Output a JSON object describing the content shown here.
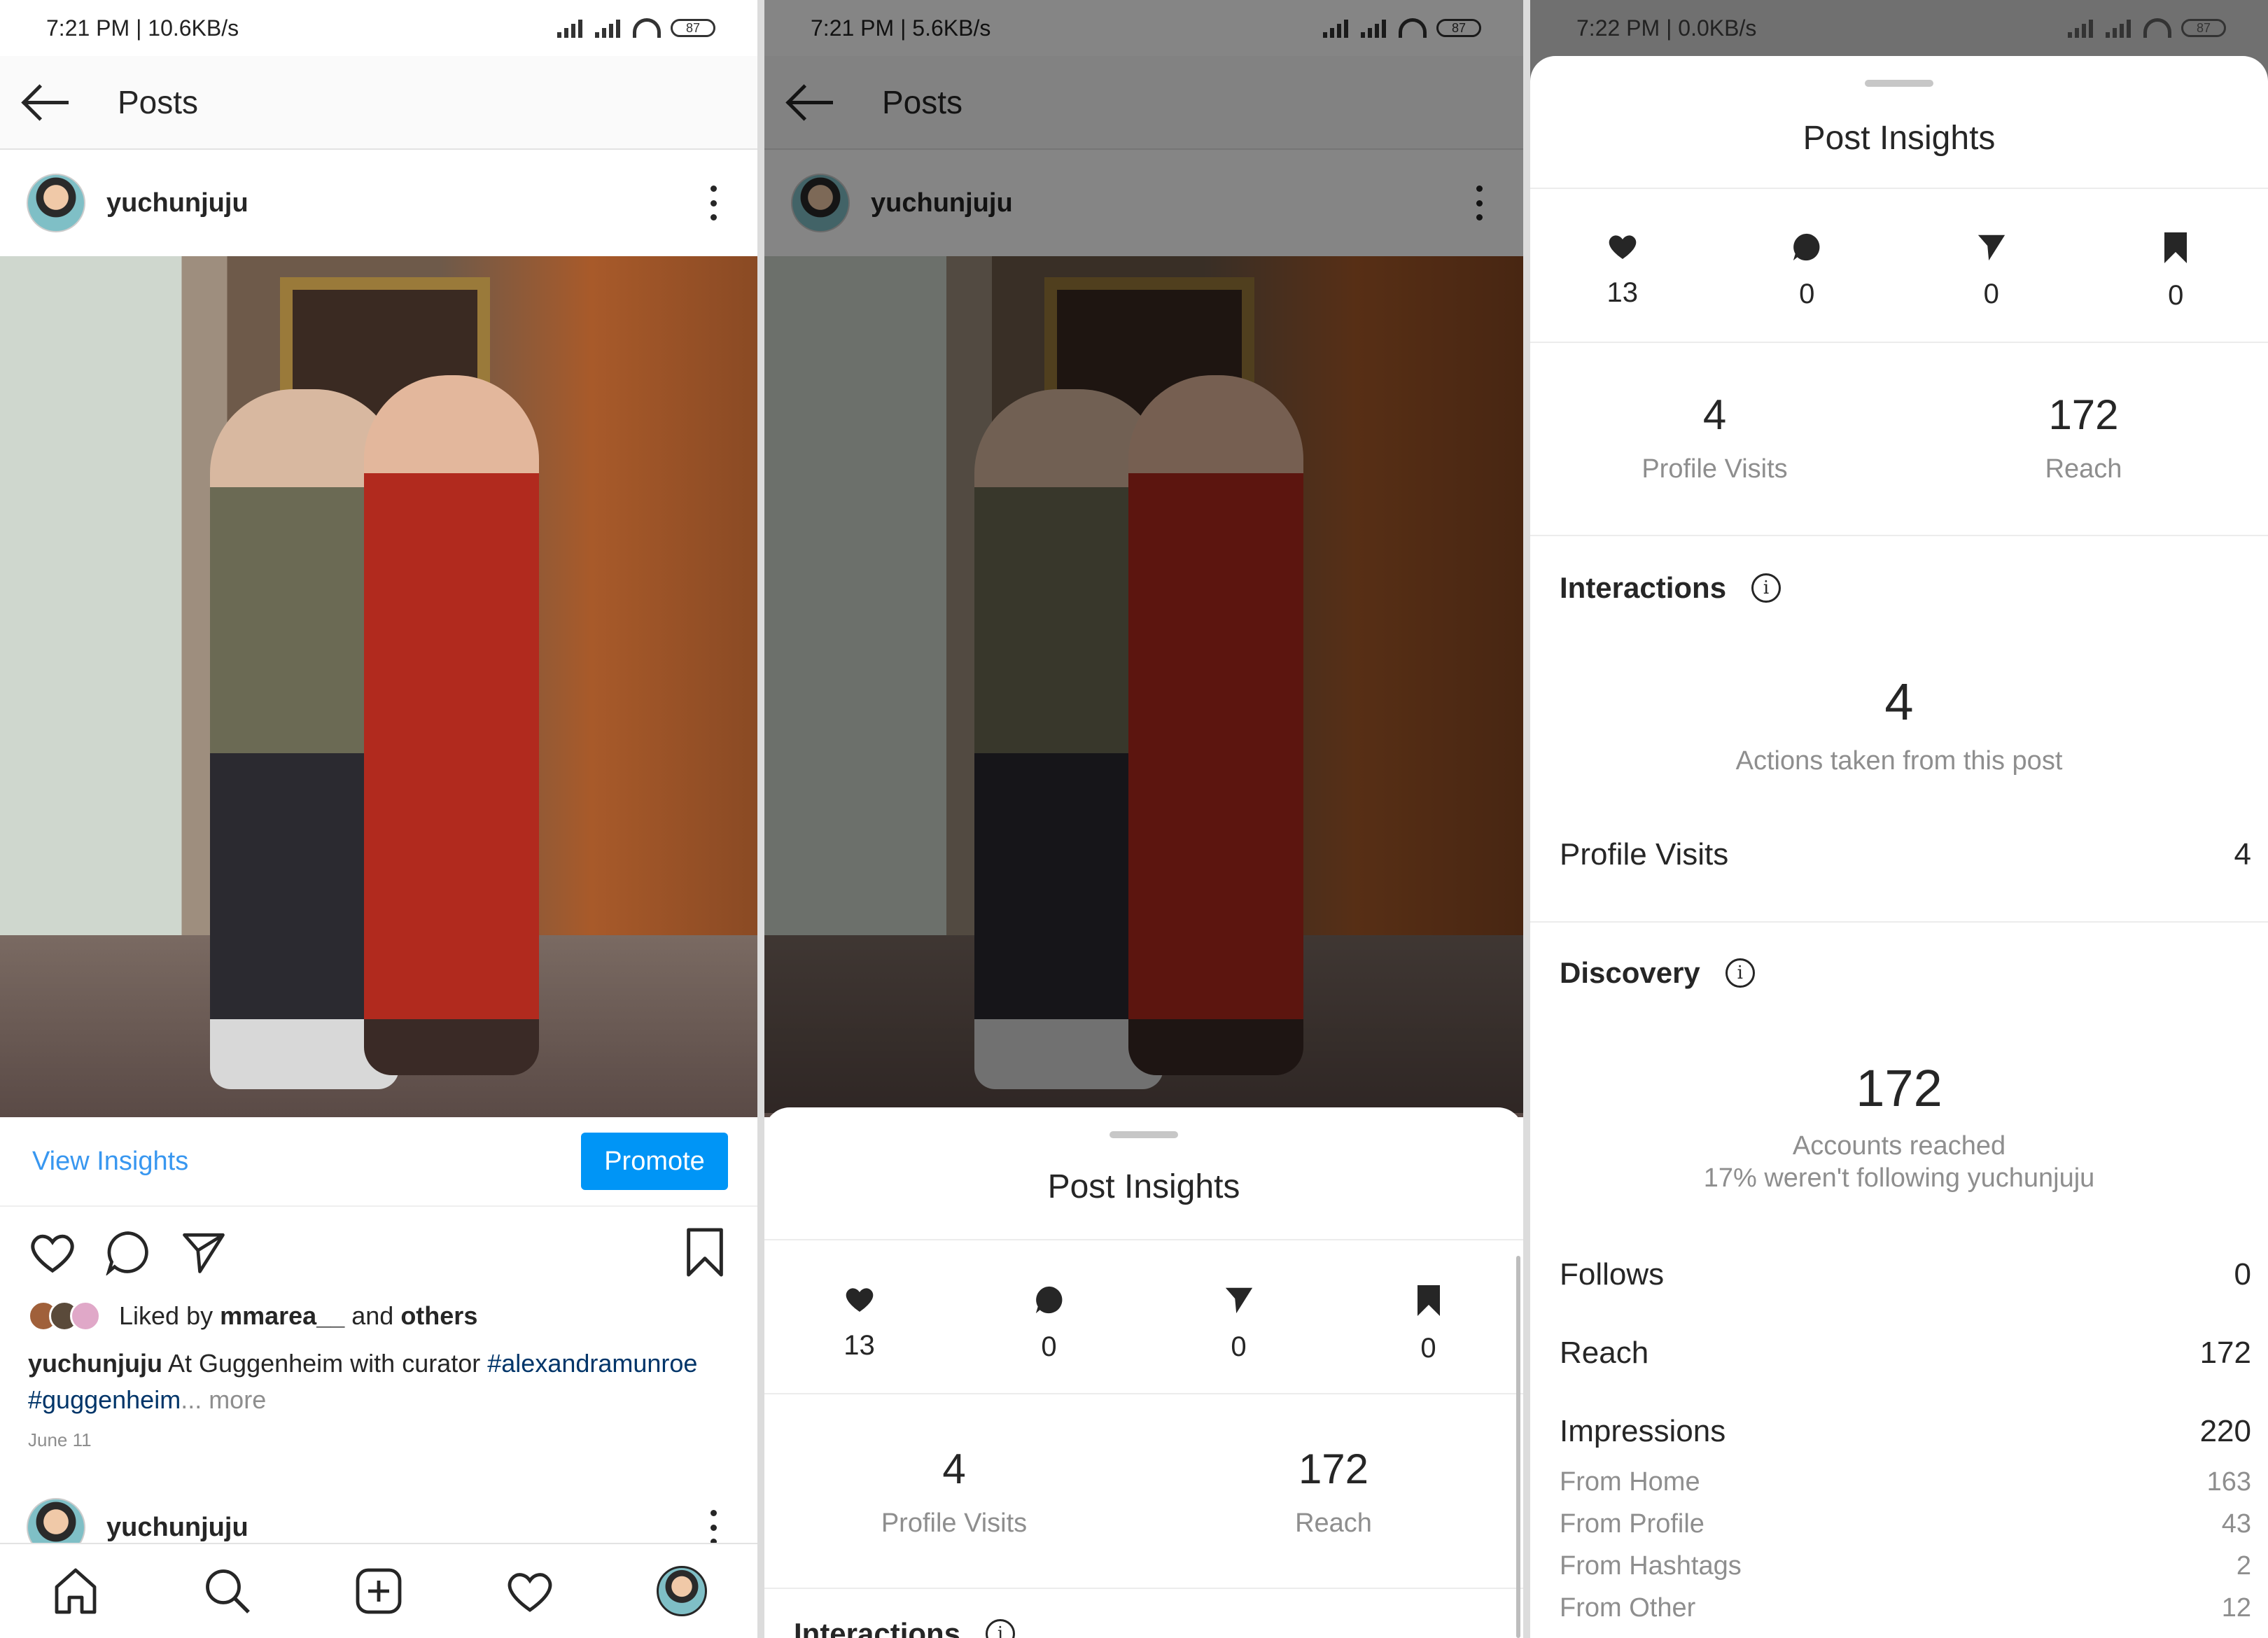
{
  "screens": [
    {
      "status": {
        "text": "7:21 PM | 10.6KB/s",
        "battery": "87"
      },
      "appbar": {
        "title": "Posts"
      },
      "post": {
        "username": "yuchunjuju",
        "view_insights": "View Insights",
        "promote": "Promote",
        "liked_prefix": "Liked by ",
        "liked_user": "mmarea__",
        "liked_mid": " and ",
        "liked_others": "others",
        "caption_user": "yuchunjuju",
        "caption_text": " At Guggenheim with curator ",
        "tag1": "#alexandramunroe",
        "tag2": "#guggenheim",
        "more": "... more",
        "date": "June 11"
      },
      "next_post": {
        "username": "yuchunjuju"
      }
    },
    {
      "status": {
        "text": "7:21 PM | 5.6KB/s",
        "battery": "87"
      },
      "appbar": {
        "title": "Posts"
      },
      "post": {
        "username": "yuchunjuju"
      },
      "sheet": {
        "title": "Post Insights",
        "counts": {
          "likes": "13",
          "comments": "0",
          "shares": "0",
          "saves": "0"
        },
        "profile_visits": {
          "value": "4",
          "label": "Profile Visits"
        },
        "reach": {
          "value": "172",
          "label": "Reach"
        },
        "partial_heading": "Interactions"
      }
    },
    {
      "status": {
        "text": "7:22 PM | 0.0KB/s",
        "battery": "87"
      },
      "sheet": {
        "title": "Post Insights",
        "counts": {
          "likes": "13",
          "comments": "0",
          "shares": "0",
          "saves": "0"
        },
        "profile_visits": {
          "value": "4",
          "label": "Profile Visits"
        },
        "reach": {
          "value": "172",
          "label": "Reach"
        },
        "interactions": {
          "heading": "Interactions",
          "total": "4",
          "total_label": "Actions taken from this post",
          "rows": [
            {
              "label": "Profile Visits",
              "value": "4"
            }
          ]
        },
        "discovery": {
          "heading": "Discovery",
          "total": "172",
          "total_label": "Accounts reached",
          "note": "17% weren't following yuchunjuju",
          "rows": [
            {
              "label": "Follows",
              "value": "0"
            },
            {
              "label": "Reach",
              "value": "172"
            },
            {
              "label": "Impressions",
              "value": "220"
            }
          ],
          "sources": [
            {
              "label": "From Home",
              "value": "163"
            },
            {
              "label": "From Profile",
              "value": "43"
            },
            {
              "label": "From Hashtags",
              "value": "2"
            },
            {
              "label": "From Other",
              "value": "12"
            }
          ]
        }
      }
    }
  ],
  "colors": {
    "link": "#3897f0",
    "promote": "#0095f6",
    "hashtag": "#003569",
    "muted": "#8e8e8e"
  },
  "icons": [
    "back-arrow-icon",
    "more-options-icon",
    "heart-icon",
    "comment-icon",
    "send-icon",
    "bookmark-icon",
    "home-icon",
    "search-icon",
    "add-icon",
    "activity-icon",
    "profile-icon",
    "info-icon"
  ]
}
